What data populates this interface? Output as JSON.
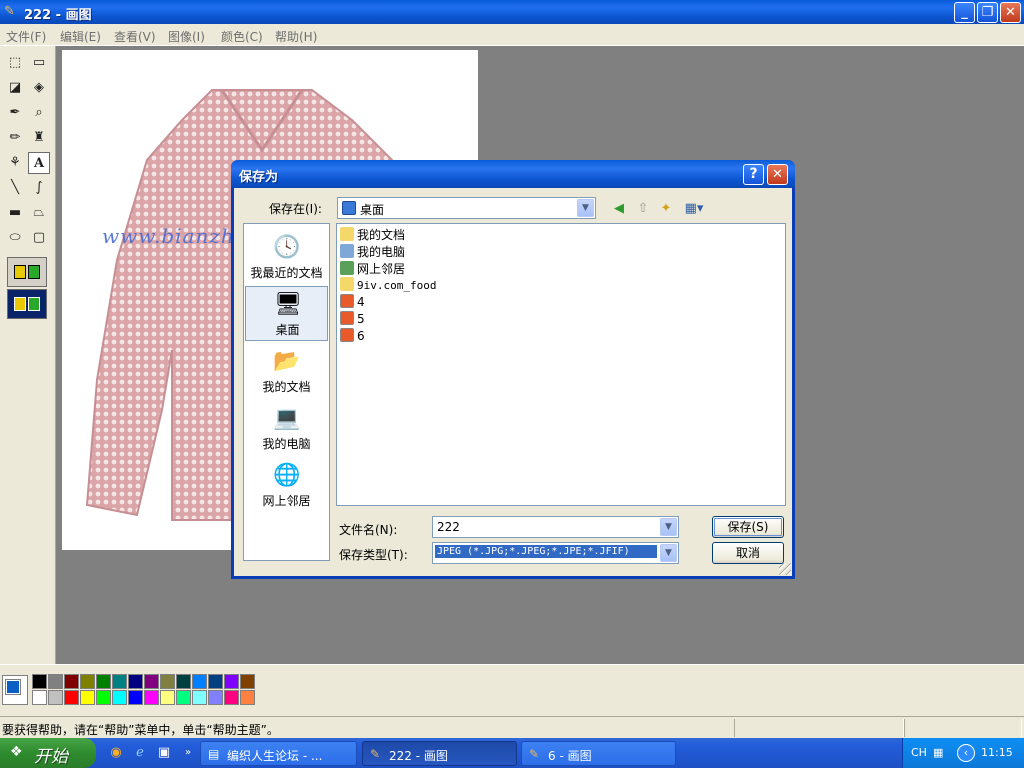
{
  "window": {
    "title": "222 - 画图",
    "controls": {
      "minimize": "_",
      "maximize": "❐",
      "close": "✕"
    }
  },
  "menu": [
    "文件(F)",
    "编辑(E)",
    "查看(V)",
    "图像(I)",
    "颜色(C)",
    "帮助(H)"
  ],
  "canvas": {
    "watermark": "www.bianzh"
  },
  "dialog": {
    "title": "保存为",
    "help": "?",
    "close": "✕",
    "save_in_label": "保存在(I):",
    "save_in_value": "桌面",
    "places": [
      {
        "label": "我最近的文档",
        "icon": "recent-documents-icon"
      },
      {
        "label": "桌面",
        "icon": "desktop-icon"
      },
      {
        "label": "我的文档",
        "icon": "my-documents-icon"
      },
      {
        "label": "我的电脑",
        "icon": "my-computer-icon"
      },
      {
        "label": "网上邻居",
        "icon": "network-places-icon"
      }
    ],
    "files": [
      {
        "name": "我的文档",
        "icon": "folder-icon"
      },
      {
        "name": "我的电脑",
        "icon": "computer-icon"
      },
      {
        "name": "网上邻居",
        "icon": "network-icon"
      },
      {
        "name": "9iv.com_food",
        "icon": "folder-icon"
      },
      {
        "name": "4",
        "icon": "shortcut-icon"
      },
      {
        "name": "5",
        "icon": "shortcut-icon"
      },
      {
        "name": "6",
        "icon": "shortcut-icon"
      }
    ],
    "filename_label": "文件名(N):",
    "filename_value": "222",
    "filetype_label": "保存类型(T):",
    "filetype_value": "JPEG (*.JPG;*.JPEG;*.JPE;*.JFIF)",
    "save_button": "保存(S)",
    "cancel_button": "取消"
  },
  "palette": {
    "foreground": "#0b5fc4",
    "row1": [
      "#000000",
      "#808080",
      "#800000",
      "#808000",
      "#008000",
      "#008080",
      "#000080",
      "#800080",
      "#808040",
      "#004040",
      "#0080ff",
      "#004080",
      "#8000ff",
      "#804000"
    ],
    "row2": [
      "#ffffff",
      "#c0c0c0",
      "#ff0000",
      "#ffff00",
      "#00ff00",
      "#00ffff",
      "#0000ff",
      "#ff00ff",
      "#ffff80",
      "#00ff80",
      "#80ffff",
      "#8080ff",
      "#ff0080",
      "#ff8040"
    ]
  },
  "status": {
    "text": "要获得帮助，请在“帮助”菜单中，单击“帮助主题”。"
  },
  "taskbar": {
    "start": "开始",
    "tasks": [
      {
        "label": "编织人生论坛 - ...",
        "active": false
      },
      {
        "label": "222 - 画图",
        "active": true
      },
      {
        "label": "6 - 画图",
        "active": false
      }
    ],
    "lang": "CH",
    "clock": "11:15"
  }
}
